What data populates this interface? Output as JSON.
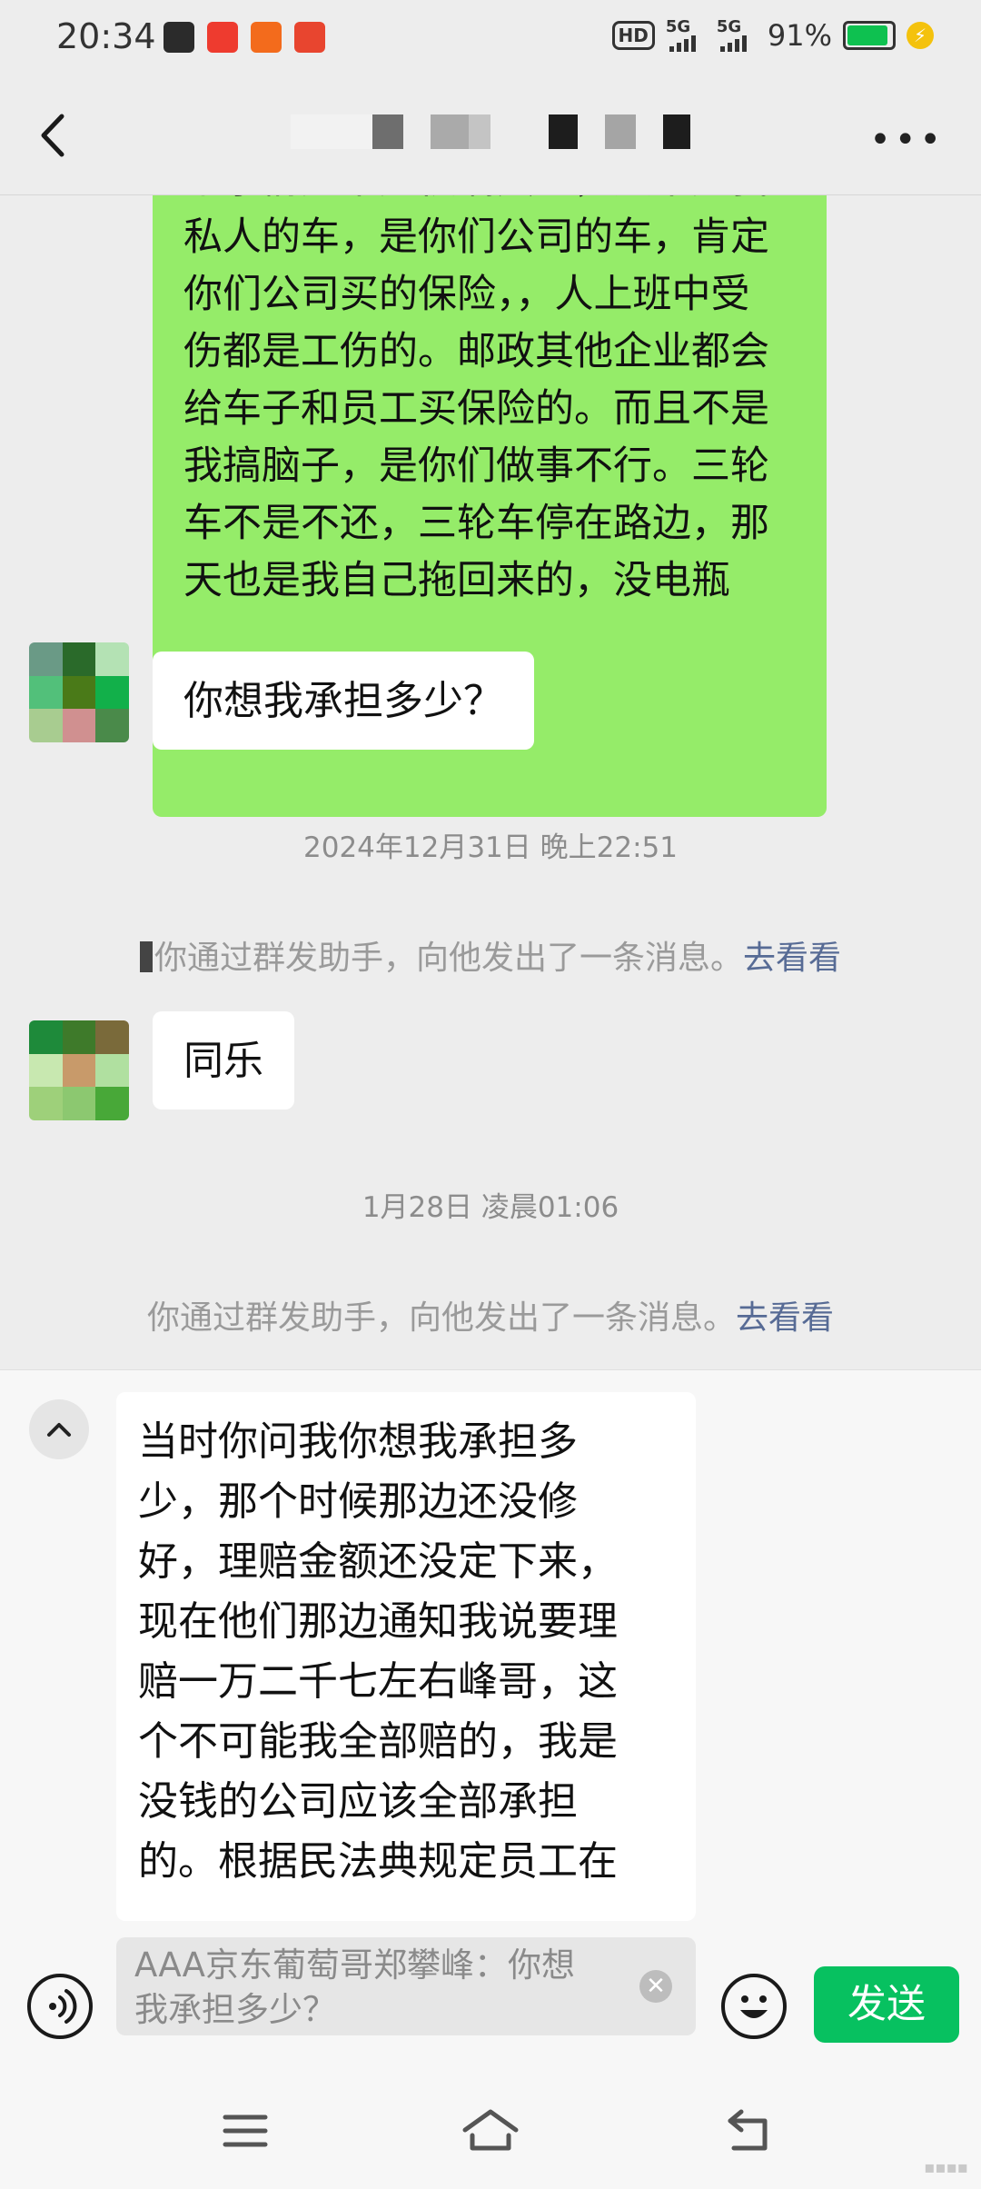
{
  "status_bar": {
    "time": "20:34",
    "battery_pct": "91%",
    "network1": "5G",
    "network2": "5G",
    "hd_label": "HD",
    "app_icons": [
      "soul-app-icon",
      "mini-game-app-icon",
      "fox-app-icon",
      "news-app-icon"
    ]
  },
  "header": {
    "back_icon": "chevron-left-icon",
    "more_icon": "more-dots-icon"
  },
  "messages": {
    "outgoing_long": [
      "个事情是不是很搞笑的，又不是我",
      "私人的车，是你们公司的车，肯定",
      "你们公司买的保险，，人上班中受",
      "伤都是工伤的。邮政其他企业都会",
      "给车子和员工买保险的。而且不是",
      "我搞脑子，是你们做事不行。三轮",
      "车不是不还，三轮车停在路边，那",
      "天也是我自己拖回来的，没电瓶"
    ],
    "incoming_1": "你想我承担多少？",
    "timestamp_1": "2024年12月31日 晚上22:51",
    "system_1": "你通过群发助手，向他发出了一条消息。",
    "system_1_link": "去看看",
    "incoming_2": "同乐",
    "timestamp_2": "1月28日 凌晨01:06",
    "system_2": "你通过群发助手，向他发出了一条消息。",
    "system_2_link": "去看看"
  },
  "composer": {
    "draft_lines": [
      "当时你问我你想我承担多",
      "少，那个时候那边还没修",
      "好，理赔金额还没定下来，",
      "现在他们那边通知我说要理",
      "赔一万二千七左右峰哥，这",
      "个不可能我全部赔的，我是",
      "没钱的公司应该全部承担",
      "的。根据民法典规定员工在"
    ],
    "quote_lines": [
      "AAA京东葡萄哥郑攀峰：你想",
      "我承担多少？"
    ],
    "send_label": "发送"
  },
  "colors": {
    "outgoing_bubble": "#95ec69",
    "send_button": "#07c160",
    "link": "#576b95",
    "background": "#ededed"
  }
}
